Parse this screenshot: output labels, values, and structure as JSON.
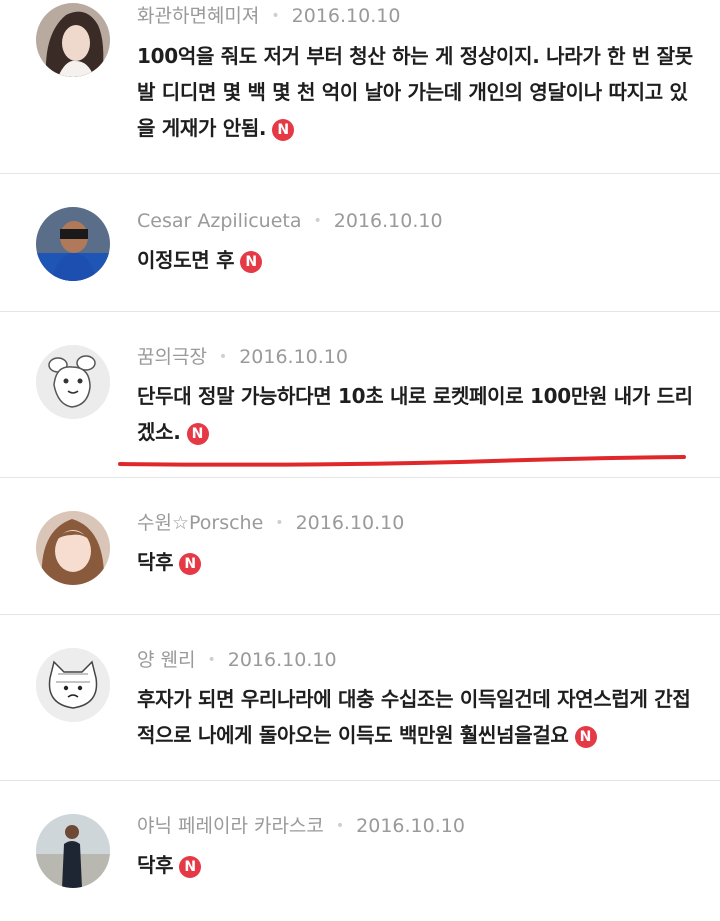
{
  "comments": [
    {
      "author": "화관하면혜미져",
      "date": "2016.10.10",
      "text": "100억을 줘도 저거 부터 청산 하는 게 정상이지. 나라가 한 번 잘못 발 디디면 몇 백 몇 천 억이 날아 가는데 개인의 영달이나 따지고 있을 게재가 안됨.",
      "badge": "N"
    },
    {
      "author": "Cesar Azpilicueta",
      "date": "2016.10.10",
      "text": "이정도면 후",
      "badge": "N"
    },
    {
      "author": "꿈의극장",
      "date": "2016.10.10",
      "text": "단두대 정말 가능하다면 10초 내로 로켓페이로 100만원 내가 드리겠소.",
      "badge": "N"
    },
    {
      "author": "수원☆Porsche",
      "date": "2016.10.10",
      "text": "닥후",
      "badge": "N"
    },
    {
      "author": "양 웬리",
      "date": "2016.10.10",
      "text": "후자가 되면 우리나라에 대충 수십조는 이득일건데 자연스럽게 간접적으로 나에게 돌아오는 이득도 백만원 훨씬넘을걸요",
      "badge": "N"
    },
    {
      "author": "야닉 페레이라 카라스코",
      "date": "2016.10.10",
      "text": "닥후",
      "badge": "N"
    }
  ],
  "colors": {
    "badge": "#e53946",
    "annotation": "#e0282b",
    "meta": "#9a9a9a"
  }
}
